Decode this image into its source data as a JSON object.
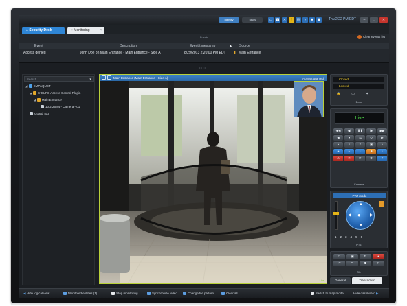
{
  "topbar": {
    "btn_active": "Identity",
    "btn_plain": "Tasks",
    "clock": "Thu 2:22 PM EDT",
    "tray_icons": [
      "monitor-icon",
      "phone-icon",
      "mute-icon",
      "alert-icon",
      "chat-icon",
      "volume-icon",
      "network-icon",
      "battery-icon"
    ]
  },
  "tabs": {
    "security_desk": "Security Desk",
    "monitoring": "Monitoring"
  },
  "events": {
    "title": "Events",
    "clear_label": "Clear events list",
    "headers": [
      "Event",
      "Description",
      "Event timestamp",
      "Source"
    ],
    "rows": [
      [
        "Access denied",
        "John Doe on Main Entrance - Main Entrance - Side A",
        "8/29/2013 2:20:00 PM EDT",
        "Main Entrance"
      ]
    ]
  },
  "tree": {
    "search_placeholder": "Search",
    "items": [
      {
        "label": "EMPAQUET",
        "indent": 0,
        "icon": "server-icon",
        "color": "#4ea0e8"
      },
      {
        "label": "C•CURE Access Control Plugin",
        "indent": 1,
        "icon": "plugin-icon",
        "color": "#e2a72a"
      },
      {
        "label": "Main Entrance",
        "indent": 2,
        "icon": "door-icon",
        "color": "#e2a72a"
      },
      {
        "label": "10.2.26.84 - Camera - 01",
        "indent": 3,
        "icon": "camera-icon",
        "color": "#c9d0d8"
      },
      {
        "label": "Guard Tour",
        "indent": 1,
        "icon": "tour-icon",
        "color": "#c9d0d8"
      }
    ]
  },
  "video": {
    "title": "Main Entrance (Main Entrance - Side A)",
    "access_status": "Access granted",
    "live_badge": "Live"
  },
  "door_panel": {
    "state1": "Closed",
    "state2": "Locked",
    "label": "Door"
  },
  "camera_panel": {
    "live": "Live",
    "label": "Camera"
  },
  "ptz_panel": {
    "mode": "PTZ mode",
    "label": "PTZ",
    "presets": [
      "1",
      "2",
      "3",
      "4",
      "5",
      "6"
    ]
  },
  "tile_panel": {
    "label": "Tile"
  },
  "right_tabs": {
    "general": "General",
    "transaction": "Transaction"
  },
  "bottombar": {
    "hide_logical": "Hide logical view",
    "monitored": "Monitored entities (1)",
    "stop": "Stop monitoring",
    "sync": "Synchronize video",
    "pattern": "Change tile pattern",
    "clear": "Clear all",
    "switch_map": "Switch to map mode",
    "hide_dash": "Hide dashboard"
  },
  "colors": {
    "accent": "#2f86d6",
    "selection_border": "#b9d13a",
    "live_green": "#4fd94a",
    "warn": "#e4b417"
  }
}
